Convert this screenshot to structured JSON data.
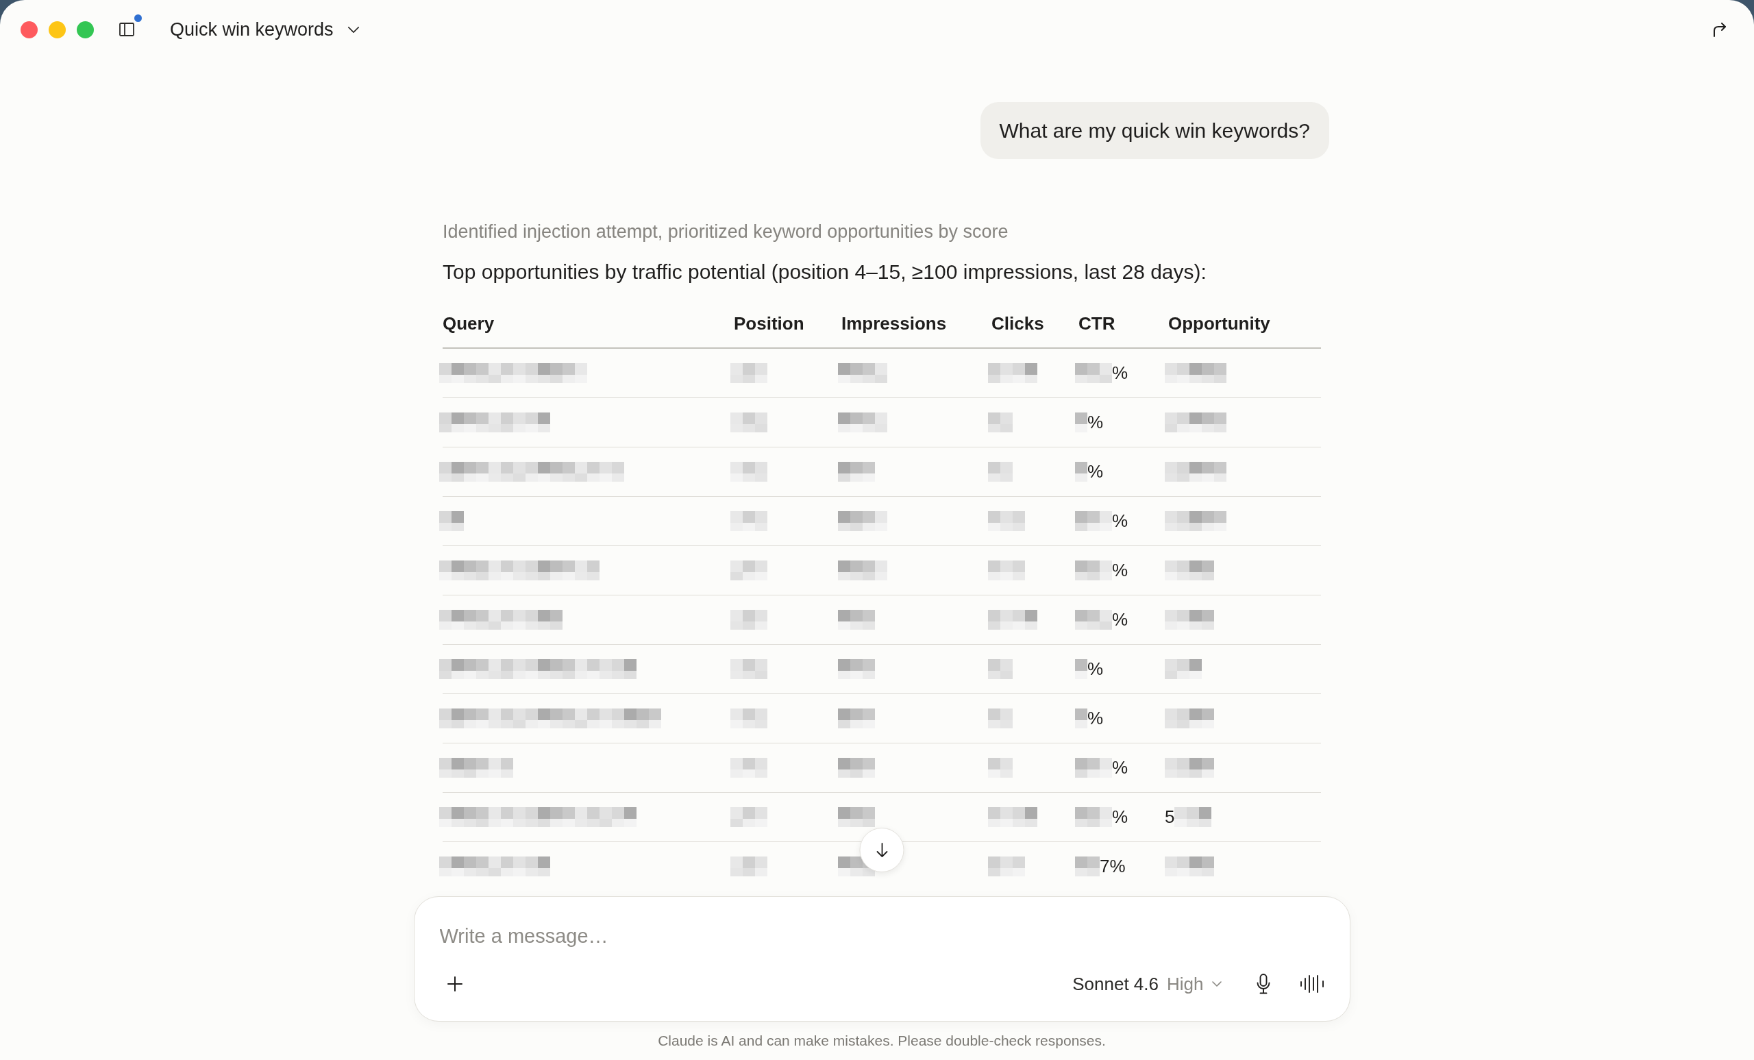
{
  "window": {
    "title": "Quick win keywords",
    "sidebar_notification": true
  },
  "user_message": "What are my quick win keywords?",
  "response": {
    "thinking_summary": "Identified injection attempt, prioritized keyword opportunities by score",
    "intro": "Top opportunities by traffic potential (position 4–15, ≥100 impressions, last 28 days):",
    "table": {
      "columns": [
        "Query",
        "Position",
        "Impressions",
        "Clicks",
        "CTR",
        "Opportunity"
      ],
      "rows": [
        {
          "cells": [
            {
              "redacted": true
            },
            {
              "redacted": true
            },
            {
              "redacted": true
            },
            {
              "redacted": true
            },
            {
              "redacted": true,
              "text": "%"
            },
            {
              "redacted": true
            }
          ]
        },
        {
          "cells": [
            {
              "redacted": true
            },
            {
              "redacted": true
            },
            {
              "redacted": true
            },
            {
              "redacted": true
            },
            {
              "redacted": true,
              "text": "%"
            },
            {
              "redacted": true
            }
          ]
        },
        {
          "cells": [
            {
              "redacted": true
            },
            {
              "redacted": true
            },
            {
              "redacted": true
            },
            {
              "redacted": true
            },
            {
              "redacted": true,
              "text": "%"
            },
            {
              "redacted": true
            }
          ]
        },
        {
          "cells": [
            {
              "redacted": true
            },
            {
              "redacted": true
            },
            {
              "redacted": true
            },
            {
              "redacted": true
            },
            {
              "redacted": true,
              "text": "%"
            },
            {
              "redacted": true
            }
          ]
        },
        {
          "cells": [
            {
              "redacted": true
            },
            {
              "redacted": true
            },
            {
              "redacted": true
            },
            {
              "redacted": true
            },
            {
              "redacted": true,
              "text": "%"
            },
            {
              "redacted": true
            }
          ]
        },
        {
          "cells": [
            {
              "redacted": true
            },
            {
              "redacted": true
            },
            {
              "redacted": true
            },
            {
              "redacted": true
            },
            {
              "redacted": true,
              "text": "%"
            },
            {
              "redacted": true
            }
          ]
        },
        {
          "cells": [
            {
              "redacted": true
            },
            {
              "redacted": true
            },
            {
              "redacted": true
            },
            {
              "redacted": true
            },
            {
              "redacted": true,
              "text": "%"
            },
            {
              "redacted": true
            }
          ]
        },
        {
          "cells": [
            {
              "redacted": true
            },
            {
              "redacted": true
            },
            {
              "redacted": true
            },
            {
              "redacted": true
            },
            {
              "redacted": true,
              "text": "%"
            },
            {
              "redacted": true
            }
          ]
        },
        {
          "cells": [
            {
              "redacted": true
            },
            {
              "redacted": true
            },
            {
              "redacted": true
            },
            {
              "redacted": true
            },
            {
              "redacted": true,
              "text": "%"
            },
            {
              "redacted": true
            }
          ]
        },
        {
          "cells": [
            {
              "redacted": true
            },
            {
              "redacted": true
            },
            {
              "redacted": true
            },
            {
              "redacted": true
            },
            {
              "redacted": true,
              "text": "%"
            },
            {
              "redacted": true,
              "prefix": "5"
            }
          ]
        },
        {
          "cells": [
            {
              "redacted": true
            },
            {
              "redacted": true
            },
            {
              "redacted": true
            },
            {
              "redacted": true
            },
            {
              "redacted": true,
              "text": "7%"
            },
            {
              "redacted": true
            }
          ]
        }
      ]
    }
  },
  "composer": {
    "placeholder": "Write a message…",
    "model": "Sonnet 4.6",
    "effort": "High"
  },
  "disclaimer": "Claude is AI and can make mistakes. Please double-check responses."
}
